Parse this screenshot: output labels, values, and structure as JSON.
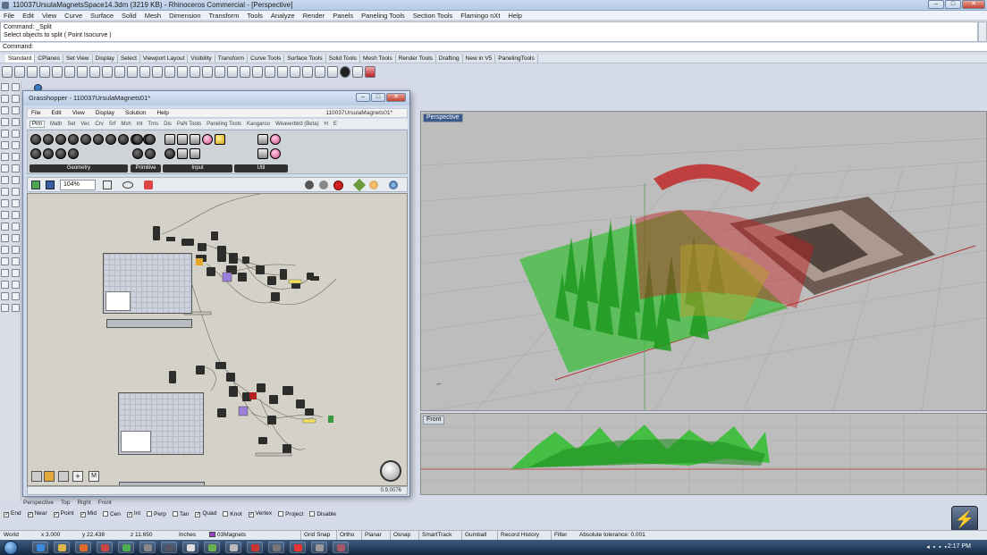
{
  "window": {
    "title": "110037UrsulaMagnetsSpace14.3dm (3219 KB) - Rhinoceros Commercial - [Perspective]"
  },
  "menu": [
    "File",
    "Edit",
    "View",
    "Curve",
    "Surface",
    "Solid",
    "Mesh",
    "Dimension",
    "Transform",
    "Tools",
    "Analyze",
    "Render",
    "Panels",
    "Paneling Tools",
    "Section Tools",
    "Flamingo nXt",
    "Help"
  ],
  "command": {
    "history_1": "Command: _Split",
    "history_2": "Select objects to split ( Point  Isocurve )",
    "prompt": "Command:"
  },
  "toolbar_tabs": [
    "Standard",
    "CPlanes",
    "Set View",
    "Display",
    "Select",
    "Viewport Layout",
    "Visibility",
    "Transform",
    "Curve Tools",
    "Surface Tools",
    "Solid Tools",
    "Mesh Tools",
    "Render Tools",
    "Drafting",
    "New in V5",
    "PanelingTools"
  ],
  "viewports": {
    "perspective": "Perspective",
    "front": "Front"
  },
  "viewport_tabs": [
    "Perspective",
    "Top",
    "Right",
    "Front"
  ],
  "grasshopper": {
    "title": "Grasshopper - 110037UrsulaMagnets01*",
    "menu": [
      "File",
      "Edit",
      "View",
      "Display",
      "Solution",
      "Help"
    ],
    "file_path": "110037UrsulaMagnets01*",
    "tabs": [
      "Prm",
      "Math",
      "Set",
      "Vec",
      "Crv",
      "Srf",
      "Msh",
      "Int",
      "Trns",
      "Dis",
      "PaN Tools",
      "Paneling Tools",
      "Kangaroo",
      "Weaverbird (Beta)",
      "H",
      "E"
    ],
    "ribbon_groups": [
      "Geometry",
      "Primitive",
      "Input",
      "Util"
    ],
    "zoom": "104%",
    "version": "0.9.0076"
  },
  "osnap": {
    "items": [
      {
        "label": "End",
        "checked": true
      },
      {
        "label": "Near",
        "checked": true
      },
      {
        "label": "Point",
        "checked": true
      },
      {
        "label": "Mid",
        "checked": true
      },
      {
        "label": "Cen",
        "checked": false
      },
      {
        "label": "Int",
        "checked": true
      },
      {
        "label": "Perp",
        "checked": false
      },
      {
        "label": "Tan",
        "checked": false
      },
      {
        "label": "Quad",
        "checked": true
      },
      {
        "label": "Knot",
        "checked": false
      },
      {
        "label": "Vertex",
        "checked": true
      },
      {
        "label": "Project",
        "checked": false
      },
      {
        "label": "Disable",
        "checked": false
      }
    ]
  },
  "status": {
    "cplane": "World",
    "x": "x 3.000",
    "y": "y 22.438",
    "z": "z 11.650",
    "units": "Inches",
    "layer": "03Magnets",
    "buttons": [
      "Grid Snap",
      "Ortho",
      "Planar",
      "Osnap",
      "SmartTrack",
      "Gumball",
      "Record History",
      "Filter"
    ],
    "tolerance": "Absolute tolerance: 0.001"
  },
  "taskbar": {
    "clock": "2:17 PM"
  },
  "colors": {
    "green_surface": "#3fbf3f",
    "red_surface": "#c02020",
    "accent": "#3b5b8a"
  }
}
